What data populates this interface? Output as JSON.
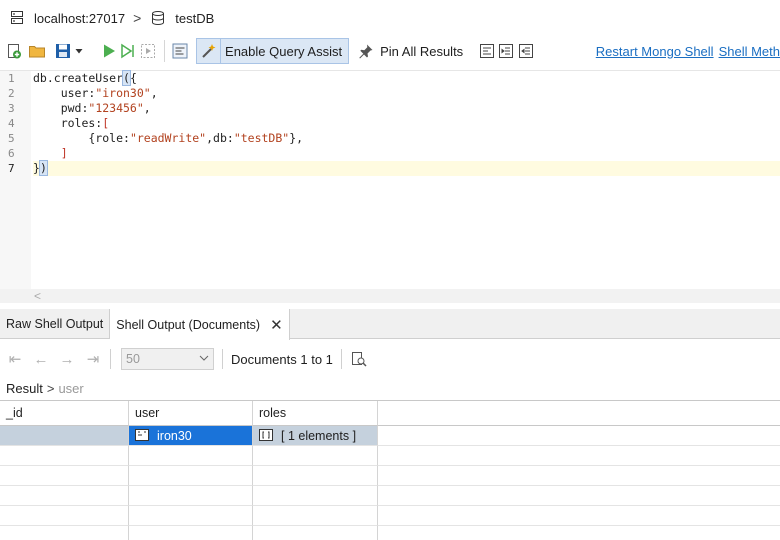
{
  "breadcrumb": {
    "connection": "localhost:27017",
    "database": "testDB"
  },
  "toolbar": {
    "query_assist_label": "Enable Query Assist",
    "pin_all_label": "Pin All Results",
    "restart_link": "Restart Mongo Shell",
    "methods_link": "Shell Meth"
  },
  "editor": {
    "line_numbers": [
      "1",
      "2",
      "3",
      "4",
      "5",
      "6",
      "7"
    ],
    "current_line": 7
  },
  "tabs": [
    {
      "label": "Raw Shell Output"
    },
    {
      "label": "Shell Output (Documents)"
    }
  ],
  "pager": {
    "page_size": "50",
    "docs_label": "Documents 1 to 1"
  },
  "result_path": {
    "root": "Result",
    "child": "user"
  },
  "grid": {
    "columns": [
      "_id",
      "user",
      "roles"
    ],
    "rows": [
      {
        "_id": "",
        "user": "iron30",
        "roles": "[ 1 elements ]"
      }
    ]
  },
  "colors": {
    "accent": "#1a73d9",
    "link": "#1a6ec2",
    "selected_row": "#c5d1dd"
  },
  "icons": [
    "server-icon",
    "database-icon",
    "new-file-icon",
    "open-folder-icon",
    "save-icon",
    "run-icon",
    "run-line-icon",
    "step-icon",
    "query-assist-icon",
    "pin-icon",
    "format-icon",
    "indent-icon",
    "outdent-icon",
    "first-page-icon",
    "prev-page-icon",
    "next-page-icon",
    "last-page-icon",
    "inspect-icon",
    "object-icon",
    "array-icon",
    "close-icon"
  ]
}
